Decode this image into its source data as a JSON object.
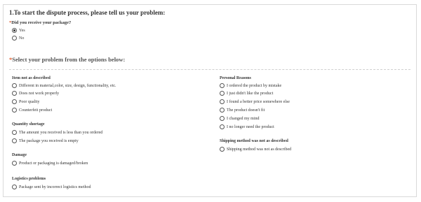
{
  "form": {
    "title": "1.To start the dispute process, please tell us your problem:",
    "received_question": {
      "label": "Did you receive your package?",
      "options": [
        "Yes",
        "No"
      ]
    },
    "problem_heading": "Select your problem from the options below:",
    "groups": {
      "item_not_described": {
        "label": "Item not as described",
        "options": [
          "Different in material,color, size, design, functionality, etc.",
          "Does not work properly",
          "Poor quality",
          "Counterfeit product"
        ]
      },
      "quantity_shortage": {
        "label": "Quantity shortage",
        "options": [
          "The amount you received is less than you ordered",
          "The package you received is empty"
        ]
      },
      "damage": {
        "label": "Damage",
        "options": [
          "Product or packaging is damaged/broken"
        ]
      },
      "logistics": {
        "label": "Logistics problems",
        "options": [
          "Package sent by incorrect logistics method"
        ]
      },
      "personal": {
        "label": "Personal Reasons",
        "options": [
          "I ordered the product by mistake",
          "I just didn't like the product",
          "I found a better price somewhere else",
          "The product doesn't fit",
          "I changed my mind",
          "I no longer need the product"
        ]
      },
      "shipping": {
        "label": "Shipping method was not as described",
        "options": [
          "Shipping method was not as described"
        ]
      }
    }
  },
  "colors": {
    "required": "#e05a2b",
    "border": "#d9d9d9"
  }
}
